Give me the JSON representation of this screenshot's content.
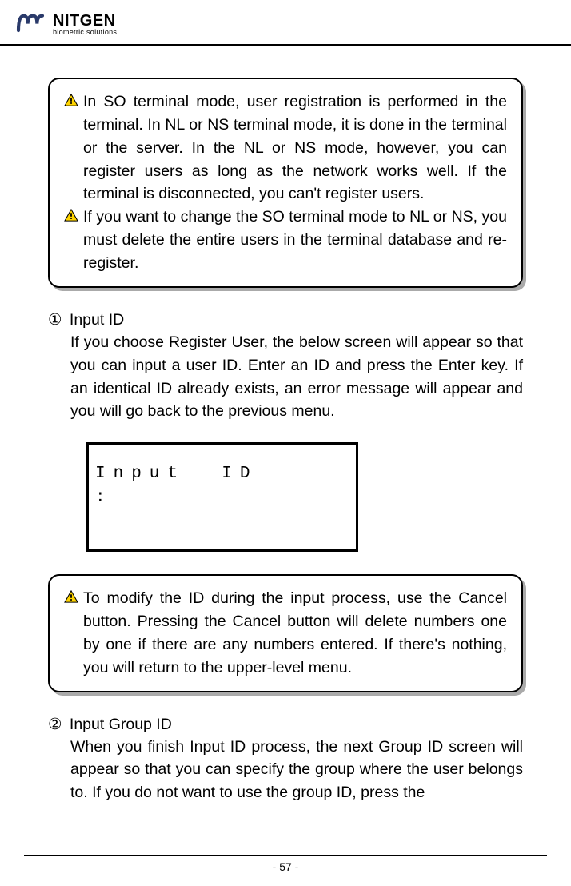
{
  "header": {
    "brand": "NITGEN",
    "tagline": "biometric solutions"
  },
  "callout1": {
    "items": [
      "In SO terminal mode, user registration is performed in the terminal. In NL or NS terminal mode, it is done in the terminal or the server. In the NL or NS mode, however, you can register users as long as the network works well. If the terminal is disconnected, you can't register users.",
      "If you want to change the SO terminal mode to NL or NS, you must delete the entire users in the terminal database and re-register."
    ]
  },
  "section1": {
    "number": "①",
    "title": "Input ID",
    "body": "If you choose Register User, the below screen will appear so that you can input a user ID. Enter an ID and press the Enter key. If an identical ID already exists, an error message will appear and you will go back to the previous menu."
  },
  "lcd": {
    "line1": "Input  ID",
    "line2": ":"
  },
  "callout2": {
    "items": [
      "To modify the ID during the input process, use the Cancel button. Pressing the Cancel button will delete numbers one by one if there are any numbers entered. If there's nothing, you will return to the upper-level menu."
    ]
  },
  "section2": {
    "number": "②",
    "title": "Input Group ID",
    "body": "When you finish Input ID process, the next Group ID screen will appear so that you can specify the group where the user belongs to. If you do not want to use the group ID, press the"
  },
  "footer": {
    "page": "- 57 -"
  }
}
